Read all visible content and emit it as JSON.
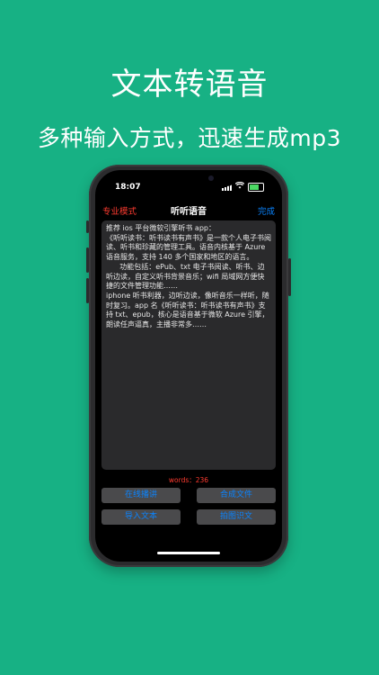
{
  "promo": {
    "title": "文本转语音",
    "subtitle": "多种输入方式，迅速生成mp3"
  },
  "status_bar": {
    "time": "18:07"
  },
  "navbar": {
    "left": "专业模式",
    "title": "听听语音",
    "right": "完成"
  },
  "editor": {
    "paragraphs": [
      "推荐 ios 平台微软引擎听书 app：",
      "《听听读书：听书读书有声书》是一款个人电子书阅读、听书和珍藏的管理工具。语音内核基于 Azure 语音服务，支持 140 多个国家和地区的语言。",
      "      功能包括：ePub、txt 电子书阅读、听书、边听边读，自定义听书背景音乐；wifi 局域网方便快捷的文件管理功能……",
      "",
      "iphone 听书利器，边听边读，像听音乐一样听，随时复习。app 名《听听读书：听书读书有声书》支持 txt、epub，核心是语音基于微软 Azure 引擎，朗读任声逼真，主播非常多……"
    ]
  },
  "word_count": "words：236",
  "buttons": {
    "online_read": "在线播讲",
    "synthesize": "合成文件",
    "import_text": "导入文本",
    "photo_ocr": "拍图识文"
  },
  "colors": {
    "background": "#17b184",
    "accent_red": "#ff3b30",
    "accent_blue": "#0a84ff"
  }
}
